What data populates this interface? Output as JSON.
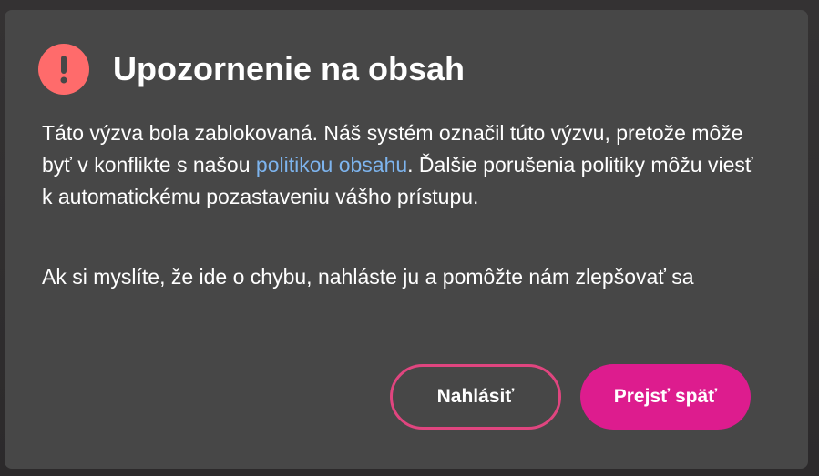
{
  "dialog": {
    "icon": "alert-icon",
    "title": "Upozornenie na obsah",
    "paragraph1": {
      "before_link": "Táto výzva bola zablokovaná. Náš systém označil túto výzvu, pretože môže byť v konflikte s našou ",
      "link_text": "politikou obsahu",
      "after_link": ". Ďalšie porušenia politiky môžu viesť k automatickému pozastaveniu vášho prístupu."
    },
    "paragraph2": "Ak si myslíte, že ide o chybu, nahláste ju a pomôžte nám zlepšovať sa",
    "buttons": {
      "report_label": "Nahlásiť",
      "back_label": "Prejsť späť"
    }
  },
  "colors": {
    "dialog_bg": "#474747",
    "alert_icon": "#ff6b6b",
    "link": "#7db4ee",
    "report_border": "#e0457f",
    "primary_button": "#dd1c8e"
  }
}
